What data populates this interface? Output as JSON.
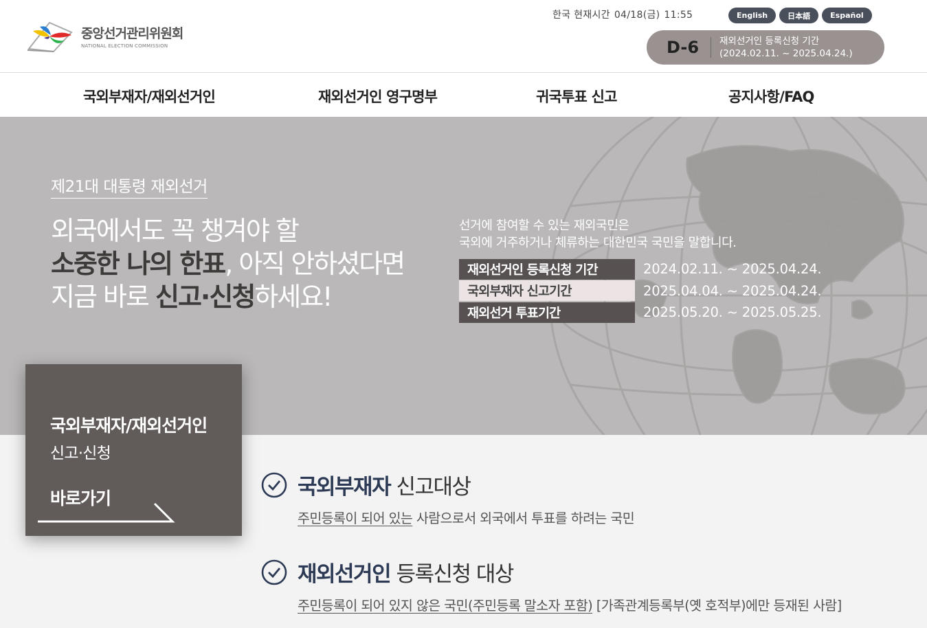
{
  "header": {
    "logo_ko": "중앙선거관리위원회",
    "logo_en": "NATIONAL ELECTION COMMISSION",
    "clock_label": "한국 현재시간",
    "clock_date": "04/18(금)",
    "clock_time": "11:55",
    "languages": [
      "English",
      "日本語",
      "Español"
    ],
    "dday": {
      "count": "D-6",
      "title": "재외선거인 등록신청 기간",
      "range": "(2024.02.11. ~ 2025.04.24.)"
    }
  },
  "nav": {
    "items": [
      "국외부재자/재외선거인",
      "재외선거인 영구명부",
      "귀국투표 신고",
      "공지사항/FAQ"
    ]
  },
  "hero": {
    "tag": "제21대 대통령 재외선거",
    "line1": "외국에서도 꼭 챙겨야 할",
    "line2_bold": "소중한 나의 한표",
    "line2_rest": ", 아직 안하셨다면",
    "line3_a": "지금 바로 ",
    "line3_bold": "신고·신청",
    "line3_b": "하세요!",
    "desc1": "선거에 참여할 수 있는 재외국민은",
    "desc2": "국외에 거주하거나 체류하는 대한민국 국민을 말합니다.",
    "periods": [
      {
        "label": "재외선거인 등록신청 기간",
        "date": "2024.02.11. ~ 2025.04.24."
      },
      {
        "label": "국외부재자 신고기간",
        "date": "2025.04.04. ~ 2025.04.24."
      },
      {
        "label": "재외선거 투표기간",
        "date": "2025.05.20. ~ 2025.05.25."
      }
    ]
  },
  "card": {
    "title": "국외부재자/재외선거인",
    "subtitle": "신고·신청",
    "go": "바로가기"
  },
  "targets": [
    {
      "title_bold": "국외부재자",
      "title_rest": " 신고대상",
      "desc_underline": "주민등록이 되어 있는",
      "desc_rest": " 사람으로서 외국에서 투표를 하려는 국민"
    },
    {
      "title_bold": "재외선거인",
      "title_rest": " 등록신청 대상",
      "desc_underline": "주민등록이 되어 있지 않은 국민(주민등록 말소자 포함)",
      "desc_rest": " [가족관계등록부(옛 호적부)에만 등재된 사람]"
    }
  ],
  "colors": {
    "hero_bg": "#bab8b8",
    "dark_label": "#575152",
    "card_bg": "#615b5a",
    "navy": "#2d3a55"
  }
}
